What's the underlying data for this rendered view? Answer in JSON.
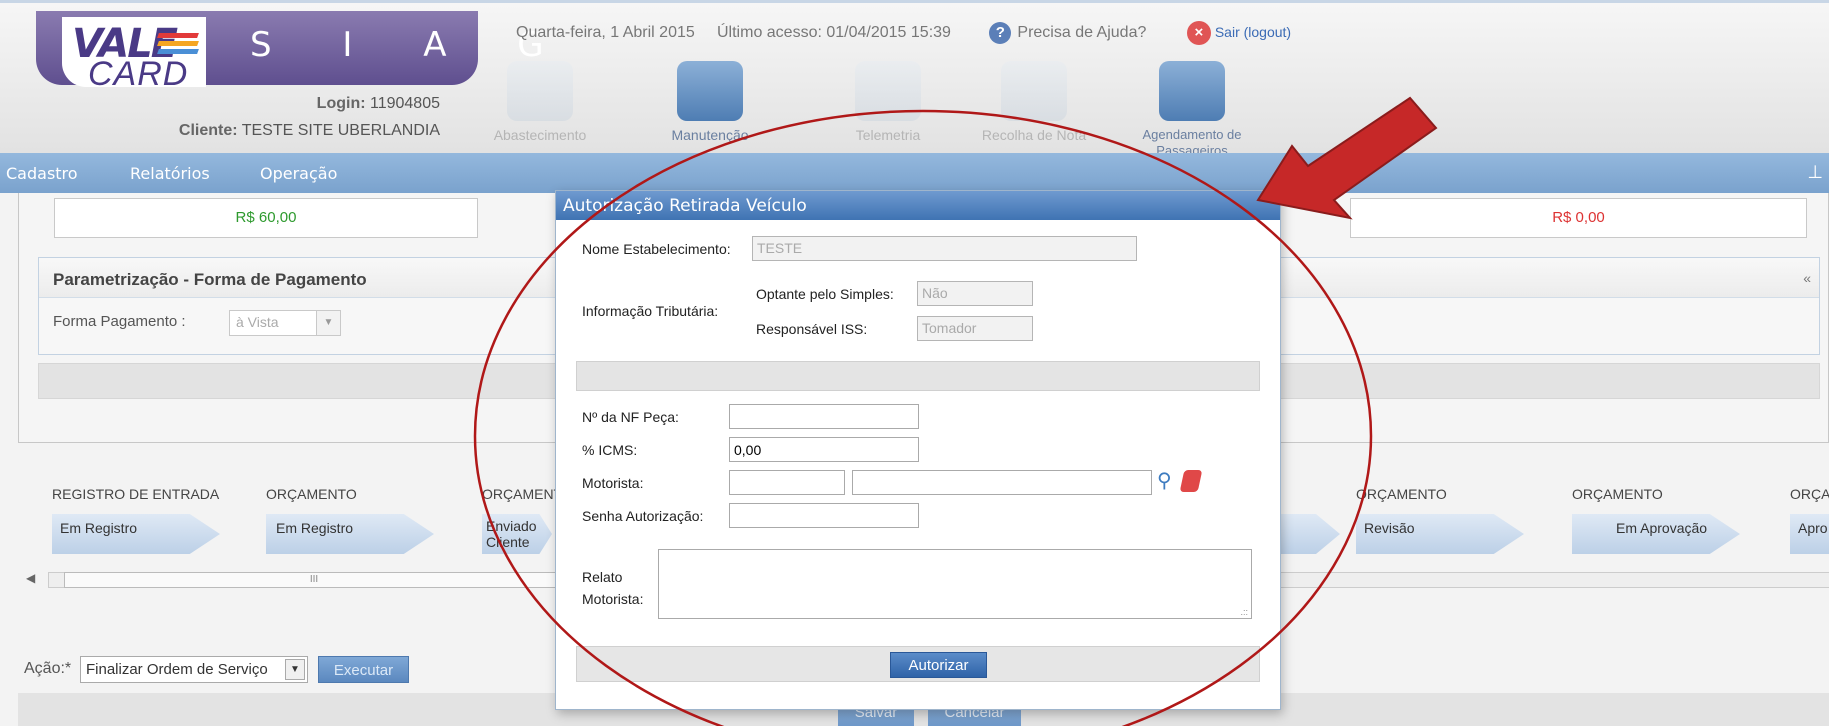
{
  "header": {
    "logo_brand": "VALE CARD",
    "logo_vale": "VALE",
    "logo_card": "CARD",
    "system_name": "S I A G",
    "login_label": "Login:",
    "login_value": "11904805",
    "client_label": "Cliente:",
    "client_value": "TESTE SITE UBERLANDIA",
    "date_text": "Quarta-feira, 1 Abril 2015",
    "last_access": "Último acesso: 01/04/2015 15:39",
    "help_text": "Precisa de Ajuda?",
    "logout_text": "Sair (logout)",
    "stripe_colors": [
      "#e23a3a",
      "#f5a623",
      "#4a8fd6"
    ]
  },
  "modules": [
    {
      "label": "Abastecimento",
      "icon": "fuel-pump-icon",
      "active": false
    },
    {
      "label": "Manutenção",
      "icon": "wrench-icon",
      "active": true
    },
    {
      "label": "Telemetria",
      "icon": "signal-icon",
      "active": false
    },
    {
      "label": "Recolha de Nota",
      "icon": "receipt-icon",
      "active": false
    },
    {
      "label": "Agendamento de Passageiros",
      "icon": "bus-icon",
      "active": true
    }
  ],
  "menu": [
    "Cadastro",
    "Relatórios",
    "Operação"
  ],
  "values": {
    "left": "R$ 60,00",
    "right": "R$ 0,00"
  },
  "param": {
    "title": "Parametrização - Forma de Pagamento",
    "forma_label": "Forma Pagamento :",
    "forma_value": "à Vista",
    "collapse": "«"
  },
  "workflow": [
    {
      "title": "REGISTRO DE ENTRADA",
      "status": "Em Registro"
    },
    {
      "title": "ORÇAMENTO",
      "status": "Em Registro"
    },
    {
      "title": "ORÇAMENTO",
      "status": "Enviado Cliente"
    },
    {
      "title": "ORÇAMENTO",
      "status": "Revisão"
    },
    {
      "title": "ORÇAMENTO",
      "status": "Em Aprovação"
    },
    {
      "title": "ORÇA",
      "status": "Apro"
    }
  ],
  "scroll_thumb": "III",
  "acao": {
    "label": "Ação:*",
    "value": "Finalizar Ordem de Serviço",
    "execute": "Executar"
  },
  "bottom": {
    "save": "Salvar",
    "cancel": "Cancelar"
  },
  "modal": {
    "title": "Autorização Retirada Veículo",
    "nome_label": "Nome Estabelecimento:",
    "nome_value": "TESTE",
    "info_label": "Informação Tributária:",
    "simples_label": "Optante pelo Simples:",
    "simples_value": "Não",
    "iss_label": "Responsável ISS:",
    "iss_value": "Tomador",
    "nf_label": "Nº da NF Peça:",
    "nf_value": "",
    "icms_label": "% ICMS:",
    "icms_value": "0,00",
    "motorista_label": "Motorista:",
    "motorista_code": "",
    "motorista_name": "",
    "senha_label": "Senha Autorização:",
    "senha_value": "",
    "relato_label_1": "Relato",
    "relato_label_2": "Motorista:",
    "relato_value": "",
    "authorize": "Autorizar"
  },
  "annotation_colors": {
    "circle": "#b01818",
    "arrow": "#c62828"
  }
}
